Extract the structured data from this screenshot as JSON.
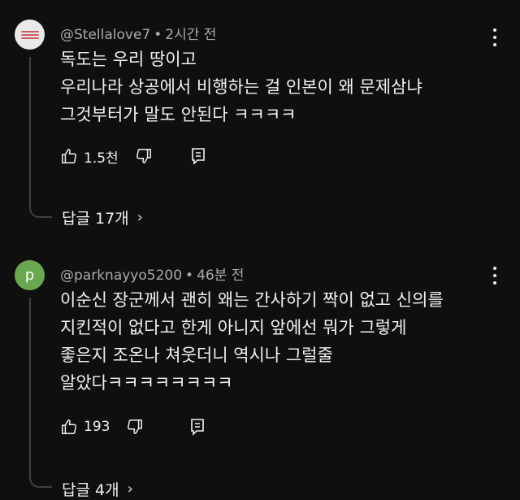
{
  "comments": [
    {
      "handle": "@Stellalove7",
      "time": "2시간 전",
      "avatar_type": "image",
      "lines": [
        "독도는 우리 땅이고",
        "우리나라 상공에서 비행하는 걸 인본이 왜 문제삼냐",
        "그것부터가 말도 안된다 ㅋㅋㅋㅋ"
      ],
      "likes": "1.5천",
      "replies": "답글 17개"
    },
    {
      "handle": "@parknayyo5200",
      "time": "46분 전",
      "avatar_type": "letter",
      "avatar_letter": "p",
      "avatar_color": "#6aa84f",
      "lines": [
        "이순신 장군께서 괜히 왜는 간사하기 짝이 없고 신의를",
        "지킨적이 없다고 한게 아니지 앞에선 뭐가 그렇게",
        "좋은지 조온나 쳐웃더니 역시나 그럴줄",
        "알았다ㅋㅋㅋㅋㅋㅋㅋㅋ"
      ],
      "likes": "193",
      "replies": "답글 4개"
    }
  ],
  "icons": {
    "more": "more-vert-icon",
    "like": "thumb-up-icon",
    "dislike": "thumb-down-icon",
    "reply": "reply-comment-icon",
    "chevron": "chevron-right-icon"
  },
  "glyphs": {
    "separator": "•",
    "chevron": "›"
  },
  "colors": {
    "background": "#0f0f0f",
    "text": "#f1f1f1",
    "meta": "#aaaaaa",
    "thread_line": "#3f3f3f"
  }
}
